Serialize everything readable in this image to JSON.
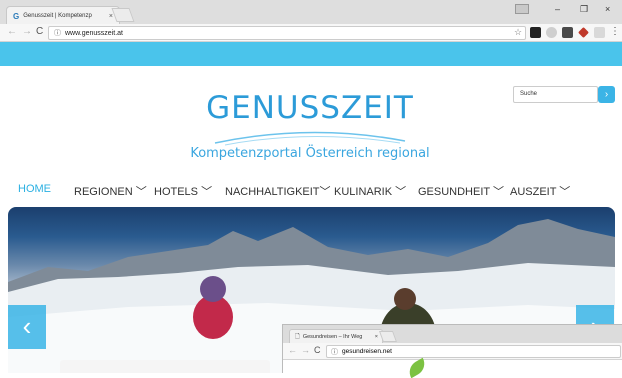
{
  "browser": {
    "tab_title": "Genusszeit | Kompetenzp",
    "tab_close": "×",
    "tab_logo": "G",
    "url": "www.genusszeit.at",
    "window_controls": {
      "minimize": "–",
      "maximize": "❐",
      "close": "×"
    }
  },
  "site": {
    "logo_title": "GENUSSZEIT",
    "logo_subtitle": "Kompetenzportal Österreich regional",
    "search_placeholder": "Suche",
    "search_button": "›",
    "nav": [
      {
        "label": "HOME",
        "active": true
      },
      {
        "label": "REGIONEN ﹀"
      },
      {
        "label": "HOTELS ﹀"
      },
      {
        "label": "NACHHALTIGKEIT﹀"
      },
      {
        "label": "KULINARIK ﹀"
      },
      {
        "label": "GESUNDHEIT ﹀"
      },
      {
        "label": "AUSZEIT ﹀"
      }
    ],
    "slider": {
      "prev": "‹",
      "next": "›"
    }
  },
  "popup_browser": {
    "tab_title": "Gesundreisen – Ihr Weg",
    "tab_close": "×",
    "url": "gesundreisen.net"
  },
  "colors": {
    "accent": "#2bb0e2",
    "band": "#4ac4eb",
    "logo": "#2c9bd8"
  }
}
